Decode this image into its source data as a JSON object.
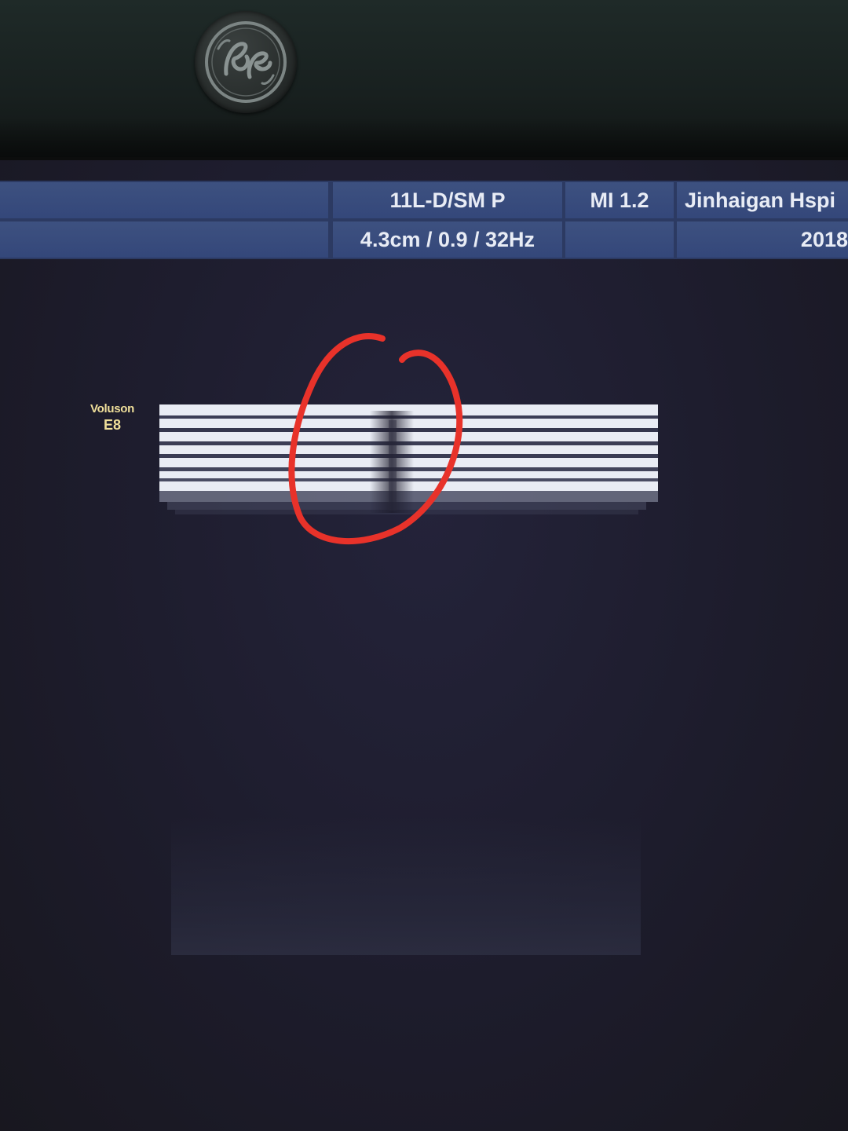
{
  "header": {
    "logo_text": "GE"
  },
  "info_bar": {
    "probe": "11L-D/SM P",
    "settings": "4.3cm / 0.9 / 32Hz",
    "mi": "MI  1.2",
    "hospital": "Jinhaigan Hspi",
    "date": "2018"
  },
  "image_label": {
    "line1": "Voluson",
    "line2": "E8"
  },
  "colors": {
    "info_bar": "#3d5180",
    "label": "#f0df9a",
    "annotation": "#e8322a",
    "screen_background": "#1d1c2c"
  }
}
